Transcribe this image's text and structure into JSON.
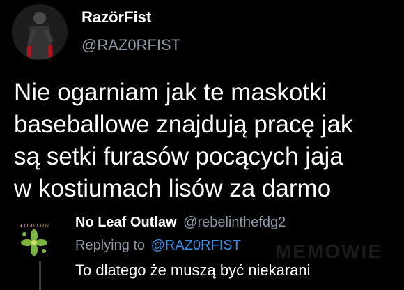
{
  "tweet": {
    "author_name": "RazörFist",
    "author_handle": "@RAZ0RFIST",
    "avatar_icon": "profile-photo-icon",
    "text_lines": [
      "Nie ogarniam jak te maskotki",
      "baseballowe znajdują pracę jak",
      "są setki furasów pocących jaja",
      "w kostiumach lisów za darmo"
    ]
  },
  "reply": {
    "author_name": "No Leaf Outlaw",
    "author_handle": "@rebelinthefdg2",
    "avatar_icon": "leaf-logo-icon",
    "replying_prefix": "Replying to",
    "replying_mention": "@RAZ0RFIST",
    "text": "To dlatego że muszą być niekarani"
  },
  "watermark": "MEMOWIE",
  "colors": {
    "background": "#000000",
    "primary_text": "#ffffff",
    "secondary_text": "#8b98a5",
    "mention": "#3d8ee0"
  }
}
